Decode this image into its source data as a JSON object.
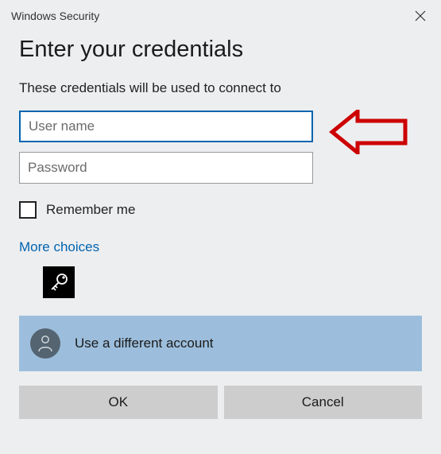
{
  "titlebar": {
    "title": "Windows Security"
  },
  "heading": "Enter your credentials",
  "subtitle": "These credentials will be used to connect to",
  "form": {
    "username": {
      "value": "",
      "placeholder": "User name"
    },
    "password": {
      "value": "",
      "placeholder": "Password"
    },
    "remember": {
      "checked": false,
      "label": "Remember me"
    }
  },
  "more_choices": {
    "label": "More choices"
  },
  "diff_account": {
    "label": "Use a different account"
  },
  "buttons": {
    "ok": "OK",
    "cancel": "Cancel"
  }
}
